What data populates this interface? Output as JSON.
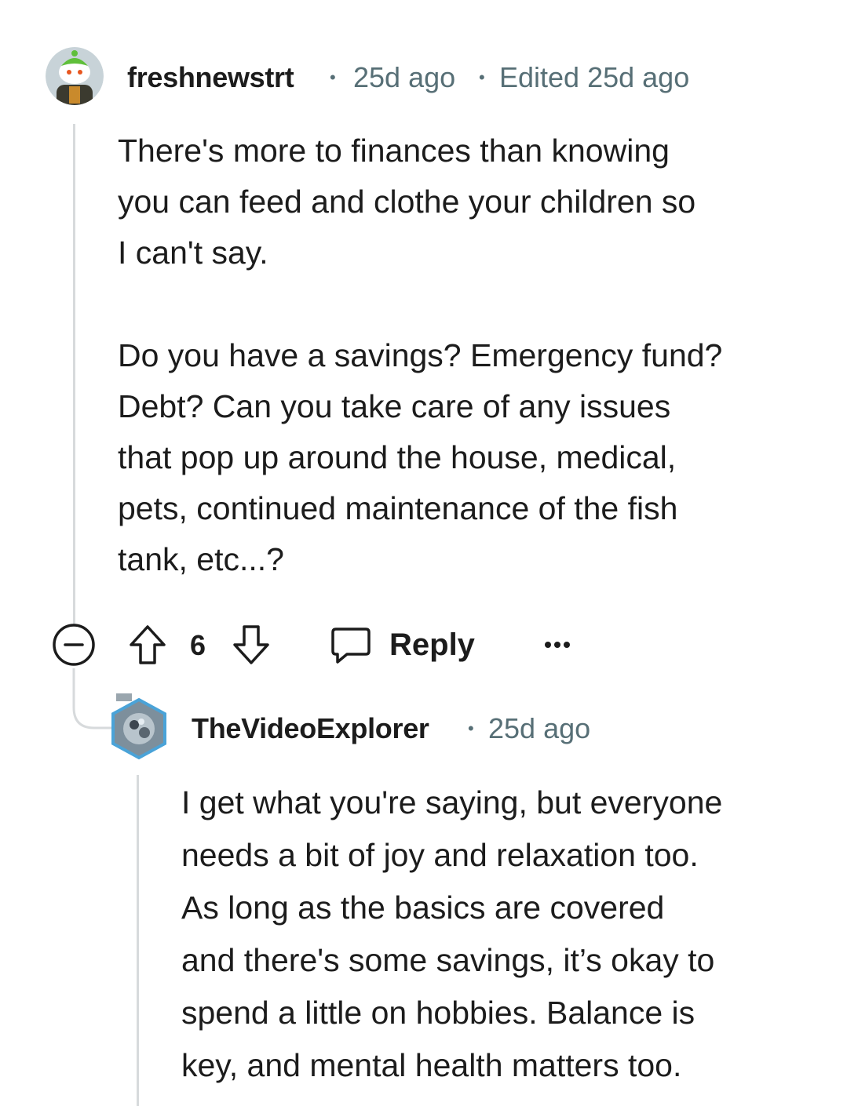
{
  "comment": {
    "username": "freshnewstrt",
    "time": "25d ago",
    "edited": "Edited 25d ago",
    "paragraphs": [
      [
        "There's more to finances than knowing",
        "you can feed and clothe your children so",
        "I can't say."
      ],
      [
        "Do you have a savings? Emergency fund?",
        "Debt? Can you take care of any issues",
        "that pop up around the house, medical,",
        "pets, continued maintenance of the fish",
        "tank, etc...?"
      ]
    ],
    "vote_count": "6",
    "reply_label": "Reply"
  },
  "reply": {
    "username": "TheVideoExplorer",
    "time": "25d ago",
    "lines": [
      "I get what you're saying, but everyone",
      "needs a bit of joy and relaxation too.",
      "As long as the basics are covered",
      "and there's some savings, it’s okay to",
      "spend a little on hobbies. Balance is",
      "key, and mental health matters too."
    ]
  },
  "icons": {
    "collapse": "collapse-minus-icon",
    "upvote": "upvote-arrow-icon",
    "downvote": "downvote-arrow-icon",
    "reply": "speech-bubble-icon",
    "more": "more-options-icon"
  },
  "colors": {
    "text": "#1c1c1c",
    "meta": "#576f76",
    "thread_line": "#d7dadc",
    "avatar1_bg": "#c8d3d8",
    "avatar2_bg": "#7d8f9c"
  }
}
